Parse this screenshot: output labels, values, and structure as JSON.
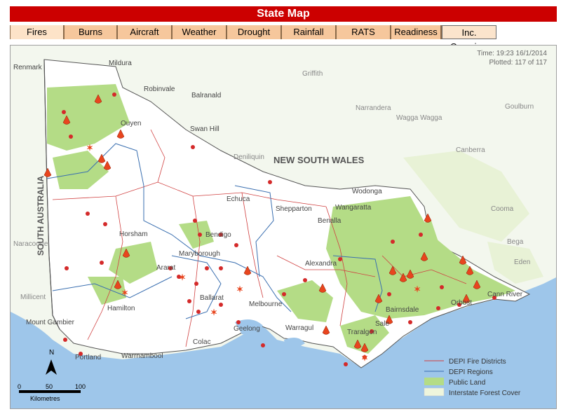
{
  "title": "State Map",
  "tabs": [
    "Fires",
    "Burns",
    "Aircraft",
    "Weather",
    "Drought",
    "Rainfall",
    "RATS",
    "Readiness",
    "Inc. Overview"
  ],
  "active_tab": "Fires",
  "info": {
    "time": "Time: 19:23 16/1/2014",
    "plotted": "Plotted: 117 of 117"
  },
  "labels": {
    "nsw": "NEW SOUTH WALES",
    "sa": "SOUTH AUSTRALIA",
    "towns": [
      "Renmark",
      "Mildura",
      "Robinvale",
      "Balranald",
      "Griffith",
      "Narrandera",
      "Wagga Wagga",
      "Goulburn",
      "Canberra",
      "Ouyen",
      "Swan Hill",
      "Deniliquin",
      "Echuca",
      "Wodonga",
      "Shepparton",
      "Wangaratta",
      "Benalla",
      "Cooma",
      "Horsham",
      "Bendigo",
      "Maryborough",
      "Naracoorte",
      "Ararat",
      "Alexandra",
      "Bega",
      "Eden",
      "Millicent",
      "Ballarat",
      "Melbourne",
      "Hamilton",
      "Mount Gambier",
      "Geelong",
      "Warragul",
      "Traralgon",
      "Sale",
      "Bairnsdale",
      "Orbost",
      "Cann River",
      "Colac",
      "Portland",
      "Warrnambool"
    ]
  },
  "legend": {
    "items": [
      "DEPI Fire Districts",
      "DEPI Regions",
      "Public Land",
      "Interstate Forest Cover"
    ],
    "colors": {
      "fire_districts": "#d04040",
      "regions": "#3a6fb0",
      "public_land": "#b4dc86",
      "forest": "#eef5dc"
    }
  },
  "scale": {
    "ticks": [
      "0",
      "50",
      "100"
    ],
    "unit": "Kilometres",
    "north": "N"
  },
  "colors": {
    "title_bg": "#cc0000",
    "tab_bg": "#f6c79c",
    "sea": "#9ec6ea",
    "land": "#ffffff",
    "nsw_land": "#f3f7ee"
  }
}
